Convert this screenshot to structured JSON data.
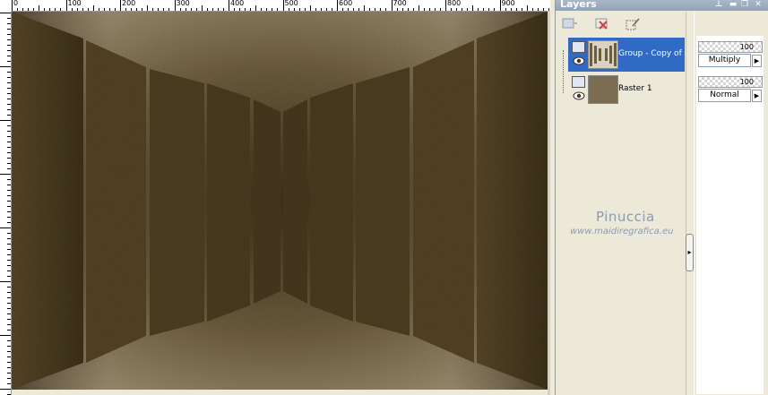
{
  "ruler": {
    "marks": [
      "0",
      "100",
      "200",
      "300",
      "400",
      "500",
      "600",
      "700",
      "800",
      "900"
    ]
  },
  "palette": {
    "title": "Layers",
    "pin_icon": "pin-icon",
    "close_icon": "close-icon"
  },
  "layers": [
    {
      "name": "Group - Copy of",
      "selected": true,
      "opacity": "100",
      "blend_mode": "Multiply"
    },
    {
      "name": "Raster 1",
      "selected": false,
      "opacity": "100",
      "blend_mode": "Normal"
    }
  ],
  "watermark": {
    "name": "Pinuccia",
    "url": "www.maidiregrafica.eu"
  },
  "colors": {
    "texture_light": "#a6977c",
    "texture_dark": "#5a4b30",
    "panel_dark": "#4b3d22",
    "selection": "#316ac5"
  }
}
